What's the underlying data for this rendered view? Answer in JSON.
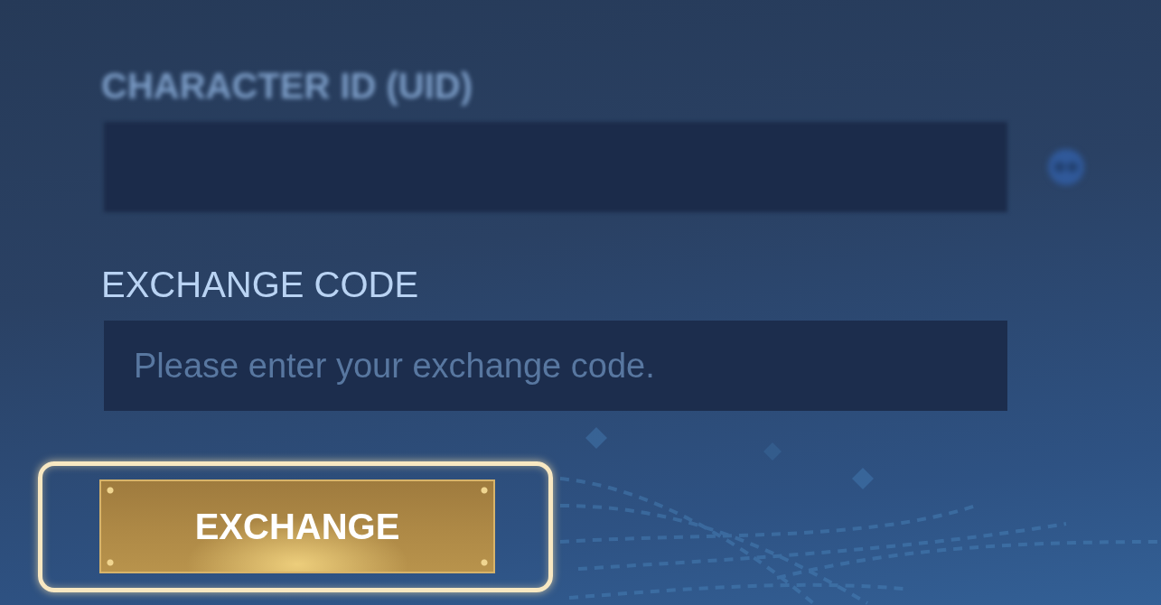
{
  "form": {
    "fields": [
      {
        "label": "CHARACTER ID (UID)",
        "blurred": true,
        "trailing_icon": true
      },
      {
        "label": "EXCHANGE CODE",
        "placeholder": "Please enter your exchange code.",
        "blurred": false,
        "trailing_icon": false
      }
    ],
    "exchange_button": {
      "label": "EXCHANGE",
      "highlighted": true
    }
  }
}
